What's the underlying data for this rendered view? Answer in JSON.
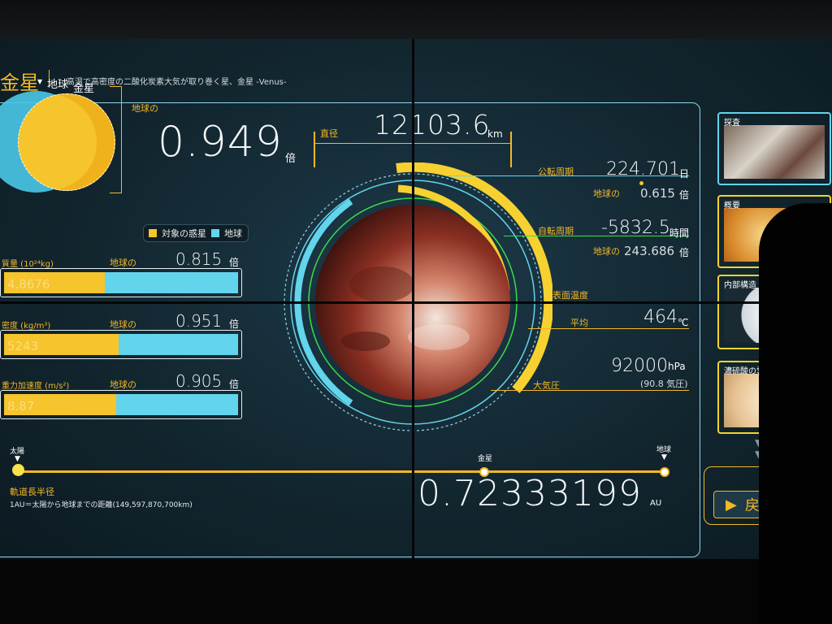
{
  "header": {
    "title": "金星",
    "subtitle": "高温で高密度の二酸化炭素大気が取り巻く星、金星 -Venus-"
  },
  "comparison": {
    "label_earth": "地球",
    "label_venus": "金星",
    "ratio_prefix": "地球の",
    "ratio_value": "0.949",
    "ratio_unit": "倍",
    "legend_target": "対象の惑星",
    "legend_earth": "地球"
  },
  "stats": [
    {
      "label": "質量 (10²⁴kg)",
      "prefix": "地球の",
      "ratio": "0.815",
      "unit": "倍",
      "value": "4.8676",
      "ratio_fraction": 0.43
    },
    {
      "label": "密度 (kg/m³)",
      "prefix": "地球の",
      "ratio": "0.951",
      "unit": "倍",
      "value": "5243",
      "ratio_fraction": 0.49
    },
    {
      "label": "重力加速度 (m/s²)",
      "prefix": "地球の",
      "ratio": "0.905",
      "unit": "倍",
      "value": "8.87",
      "ratio_fraction": 0.48
    }
  ],
  "diameter": {
    "label": "直径",
    "value": "12103.6",
    "unit": "km"
  },
  "orbital_period": {
    "label": "公転周期",
    "value": "224.701",
    "unit": "日",
    "earth_prefix": "地球の",
    "earth_ratio": "0.615",
    "earth_unit": "倍"
  },
  "rotation_period": {
    "label": "自転周期",
    "value": "-5832.5",
    "unit": "時間",
    "earth_prefix": "地球の",
    "earth_ratio": "243.686",
    "earth_unit": "倍"
  },
  "surface_temp": {
    "label": "表面温度",
    "avg_label": "平均",
    "value": "464",
    "unit": "℃"
  },
  "atmosphere": {
    "label": "大気圧",
    "value": "92000",
    "unit": "hPa",
    "sub": "(90.8 気圧)"
  },
  "orbit": {
    "sun_label": "太陽",
    "venus_label": "金星",
    "earth_label": "地球",
    "title": "軌道長半径",
    "note": "1AU＝太陽から地球までの距離(149,597,870,700km)",
    "value": "0.72333199",
    "unit": "AU",
    "venus_position": 0.723
  },
  "thumbnails": [
    {
      "label": "探査"
    },
    {
      "label": "概要"
    },
    {
      "label": "内部構造"
    },
    {
      "label": "濃硫酸の雲"
    }
  ],
  "back_button": {
    "label": "戻る"
  },
  "colors": {
    "accent": "#f4b826",
    "cyan": "#62d4ec",
    "frame": "#8fd6ef",
    "green": "#3ddc4a"
  }
}
